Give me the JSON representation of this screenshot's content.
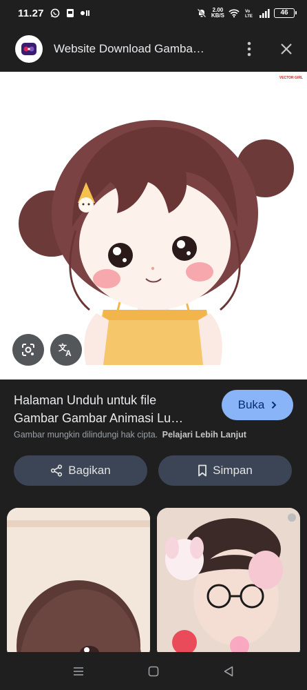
{
  "status_bar": {
    "time": "11.27",
    "speed_value": "2.00",
    "speed_unit": "KB/S",
    "battery": "46"
  },
  "app_bar": {
    "title": "Website Download Gamba…"
  },
  "image": {
    "watermark": "VECTOR GIRL"
  },
  "details": {
    "title_line1": "Halaman Unduh untuk file",
    "title_line2": "Gambar Gambar Animasi Lu…",
    "open_label": "Buka",
    "copyright_text": "Gambar mungkin dilindungi hak cipta.",
    "learn_more": "Pelajari Lebih Lanjut",
    "share_label": "Bagikan",
    "save_label": "Simpan"
  },
  "colors": {
    "background": "#1f1f1f",
    "accent": "#8ab4f8",
    "secondary_button": "#3c4556"
  }
}
